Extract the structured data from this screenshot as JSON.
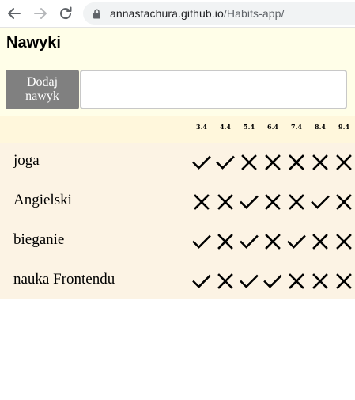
{
  "browser": {
    "url_host": "annastachura.github.io",
    "url_path": "/Habits-app/",
    "back_icon": "arrow-left-icon",
    "forward_icon": "arrow-right-icon",
    "reload_icon": "reload-icon",
    "lock_icon": "lock-icon"
  },
  "app": {
    "title": "Nawyki",
    "add_button_label": "Dodaj nawyk",
    "input_value": "",
    "input_placeholder": "",
    "colors": {
      "header_bg": "#fffee8",
      "dates_bg": "#fff7dc",
      "rows_bg": "#fcf3e4",
      "button_bg": "#808080"
    }
  },
  "dates": [
    "3.4",
    "4.4",
    "5.4",
    "6.4",
    "7.4",
    "8.4",
    "9.4"
  ],
  "habits": [
    {
      "name": "joga",
      "marks": [
        "done",
        "done",
        "missed",
        "missed",
        "missed",
        "missed",
        "missed"
      ]
    },
    {
      "name": "Angielski",
      "marks": [
        "missed",
        "missed",
        "done",
        "missed",
        "missed",
        "done",
        "missed"
      ]
    },
    {
      "name": "bieganie",
      "marks": [
        "done",
        "missed",
        "done",
        "missed",
        "done",
        "missed",
        "missed"
      ]
    },
    {
      "name": "nauka Frontendu",
      "marks": [
        "done",
        "missed",
        "done",
        "done",
        "missed",
        "missed",
        "missed"
      ]
    }
  ]
}
